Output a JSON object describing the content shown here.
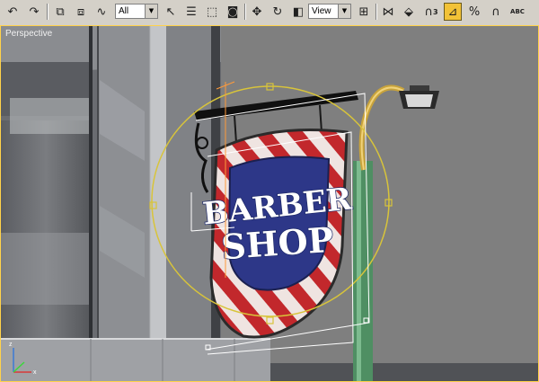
{
  "toolbar": {
    "selection_filter": "All",
    "coord_system": "View",
    "angle_snap_superscript": "3",
    "percent_snap_label": "%",
    "spinner_snap_label": "ABC",
    "icons": [
      "undo-icon",
      "redo-icon",
      "link-icon",
      "unlink-icon",
      "bind-space-warp-icon",
      "select-icon",
      "select-by-name-icon",
      "rect-region-icon",
      "window-crossing-icon",
      "move-icon",
      "rotate-icon",
      "scale-icon",
      "pivot-icon",
      "mirror-icon",
      "align-icon",
      "snaps-3d-icon",
      "angle-snap-icon",
      "percent-snap-icon",
      "spinner-snap-icon"
    ]
  },
  "viewport": {
    "label": "Perspective",
    "background_color": "#7f7f7f",
    "active_border_color": "#ffd24a"
  },
  "sign": {
    "line1": "BARBER",
    "line2": "SHOP"
  }
}
